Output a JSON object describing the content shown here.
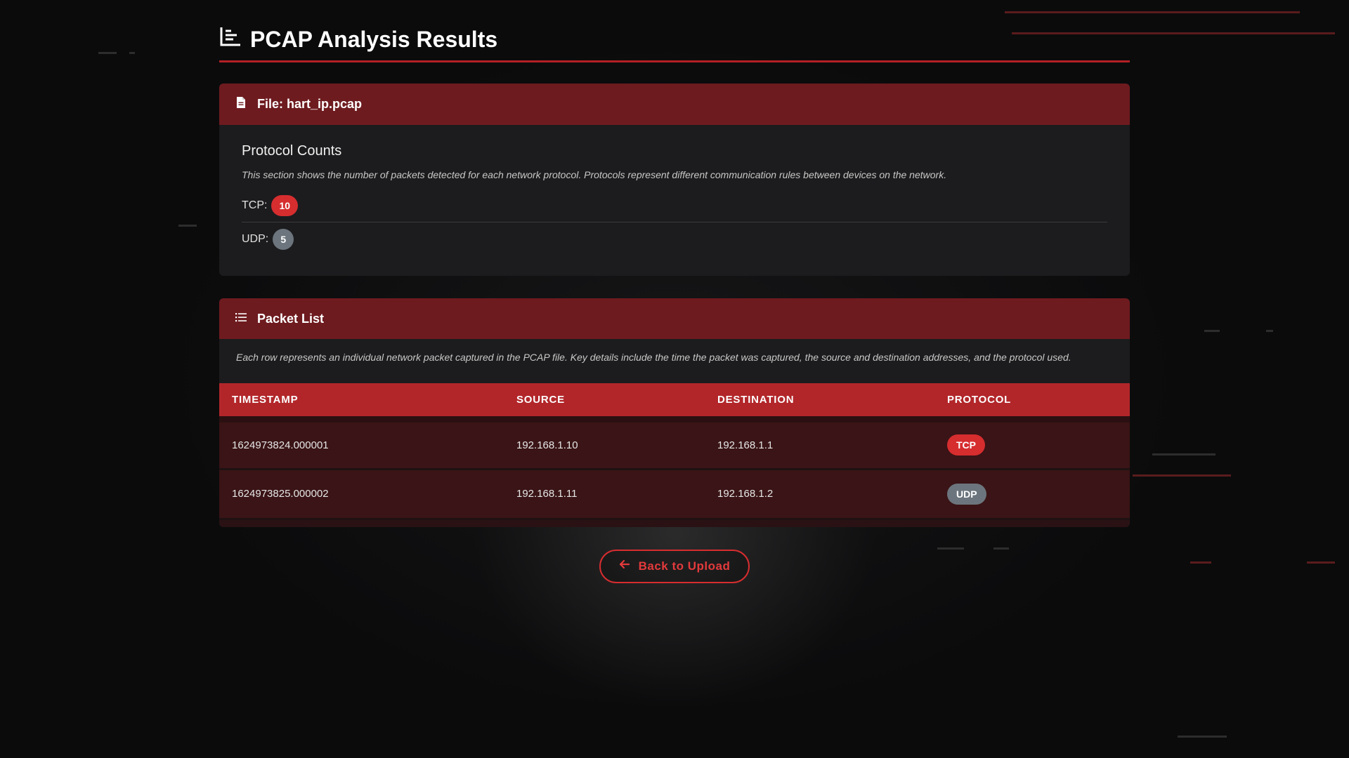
{
  "page": {
    "title": "PCAP Analysis Results"
  },
  "file_card": {
    "header": "File: hart_ip.pcap",
    "section_title": "Protocol Counts",
    "description": "This section shows the number of packets detected for each network protocol. Protocols represent different communication rules between devices on the network.",
    "protocols": [
      {
        "label": "TCP:",
        "count": "10",
        "color": "#d62d2f"
      },
      {
        "label": "UDP:",
        "count": "5",
        "color": "#6c757d"
      }
    ]
  },
  "packet_card": {
    "header": "Packet List",
    "description": "Each row represents an individual network packet captured in the PCAP file. Key details include the time the packet was captured, the source and destination addresses, and the protocol used.",
    "columns": [
      "TIMESTAMP",
      "SOURCE",
      "DESTINATION",
      "PROTOCOL"
    ],
    "rows": [
      {
        "timestamp": "1624973824.000001",
        "source": "192.168.1.10",
        "destination": "192.168.1.1",
        "protocol": "TCP",
        "color": "#d62d2f"
      },
      {
        "timestamp": "1624973825.000002",
        "source": "192.168.1.11",
        "destination": "192.168.1.2",
        "protocol": "UDP",
        "color": "#6c757d"
      }
    ]
  },
  "back_button": {
    "label": "Back to Upload"
  },
  "icons": {
    "title": "chart-bar-icon",
    "file": "file-icon",
    "list": "list-icon",
    "back": "arrow-left-icon"
  },
  "colors": {
    "accent": "#b2262a",
    "header_bg": "#6e1b1f",
    "card_bg": "#1c1c1e"
  }
}
